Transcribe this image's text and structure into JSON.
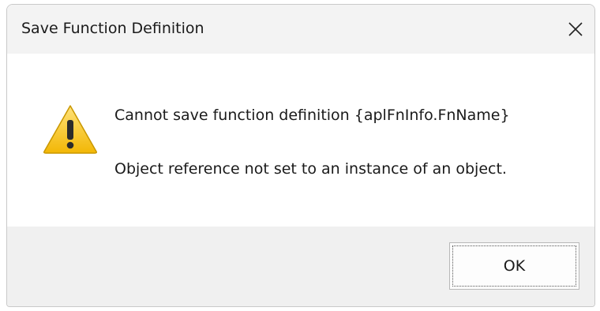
{
  "window": {
    "title": "Save Function Definition",
    "close_icon": "close-icon"
  },
  "message": {
    "icon": "warning-icon",
    "line1": "Cannot save function definition {aplFnInfo.FnName}",
    "line2": "Object reference not set to an instance of an object."
  },
  "buttons": {
    "ok_label": "OK"
  },
  "colors": {
    "titlebar_bg": "#f3f3f3",
    "footer_bg": "#f0f0f0",
    "warning_yellow": "#f5c518"
  }
}
